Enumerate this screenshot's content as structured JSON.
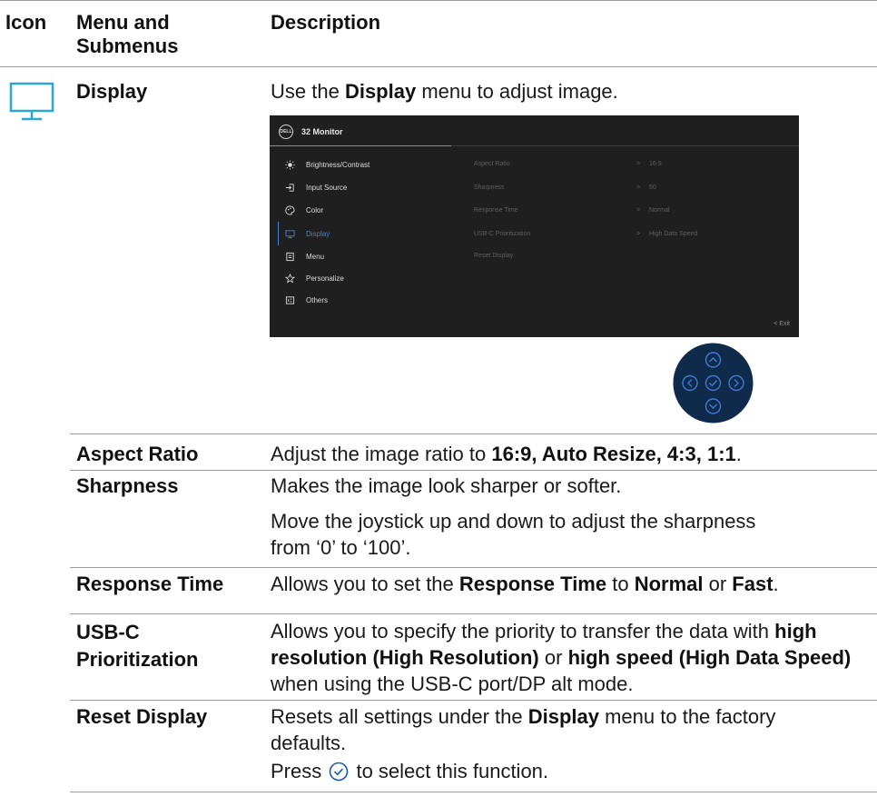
{
  "table": {
    "headers": {
      "icon": "Icon",
      "menu": "Menu and Submenus",
      "desc": "Description"
    },
    "display_row": {
      "icon_name": "monitor-icon",
      "label": "Display",
      "desc_pre": "Use the ",
      "desc_bold": "Display",
      "desc_post": " menu to adjust image."
    },
    "rows": {
      "aspect": {
        "label": "Aspect Ratio",
        "pre": "Adjust the image ratio to ",
        "bold": "16:9, Auto Resize, 4:3, 1:1",
        "post": "."
      },
      "sharpness": {
        "label": "Sharpness",
        "line1": "Makes the image look sharper or softer.",
        "line2": "Move the joystick up and down to adjust the sharpness from ‘0’ to ‘100’."
      },
      "response": {
        "label": "Response Time",
        "pre": "Allows you to set the ",
        "bold1": "Response Time",
        "mid1": " to ",
        "bold2": "Normal",
        "mid2": " or ",
        "bold3": "Fast",
        "post": "."
      },
      "usbc": {
        "label": "USB-C Prioritization",
        "pre": "Allows you to specify the priority to transfer the data with ",
        "bold1": "high resolution (High Resolution)",
        "mid": " or ",
        "bold2": "high speed (High Data Speed)",
        "post": " when using the USB-C port/DP alt mode."
      },
      "reset": {
        "label": "Reset Display",
        "pre": "Resets all settings under the ",
        "bold": "Display",
        "post": " menu to the factory defaults.",
        "press_pre": "Press ",
        "press_icon": "check-circle-icon",
        "press_post": " to select this function."
      }
    }
  },
  "osd": {
    "logo": "DELL",
    "title": "32 Monitor",
    "menu": [
      {
        "label": "Brightness/Contrast",
        "icon": "sun-icon"
      },
      {
        "label": "Input Source",
        "icon": "input-icon"
      },
      {
        "label": "Color",
        "icon": "palette-icon"
      },
      {
        "label": "Display",
        "icon": "monitor-icon",
        "active": true
      },
      {
        "label": "Menu",
        "icon": "menu-icon"
      },
      {
        "label": "Personalize",
        "icon": "star-icon"
      },
      {
        "label": "Others",
        "icon": "others-icon"
      }
    ],
    "options": [
      {
        "label": "Aspect Ratio",
        "arrow": ">",
        "value": "16:9"
      },
      {
        "label": "Sharpness",
        "arrow": ">",
        "value": "50"
      },
      {
        "label": "Response Time",
        "arrow": ">",
        "value": "Normal"
      },
      {
        "label": "USB-C Prioritization",
        "arrow": ">",
        "value": "High Data Speed"
      },
      {
        "label": "Reset Display",
        "arrow": "",
        "value": ""
      }
    ],
    "exit": "<  Exit",
    "accent_color": "#4a7fd0",
    "background_color": "#1f1f1f"
  },
  "joystick": {
    "icon_name": "joystick-icon",
    "color": "#102a4c",
    "accent_color": "#3f7bd6"
  }
}
